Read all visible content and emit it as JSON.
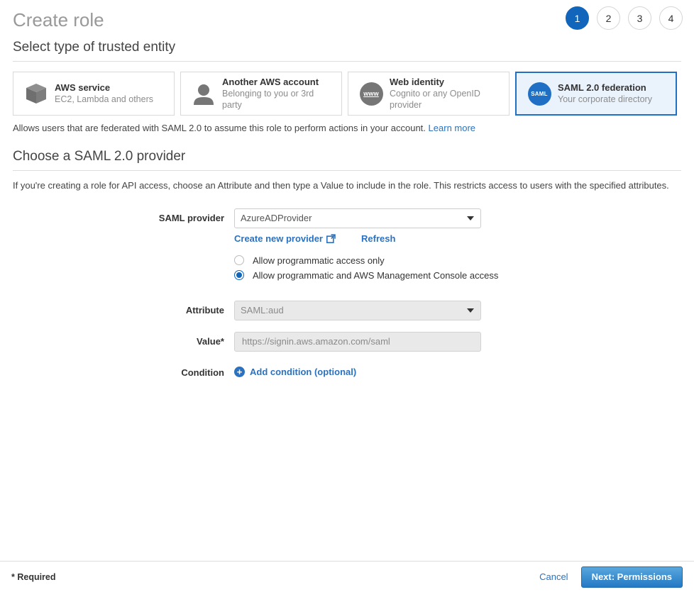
{
  "header": {
    "title": "Create role",
    "steps": [
      {
        "label": "1",
        "active": true
      },
      {
        "label": "2",
        "active": false
      },
      {
        "label": "3",
        "active": false
      },
      {
        "label": "4",
        "active": false
      }
    ]
  },
  "section_entity": {
    "heading": "Select type of trusted entity",
    "cards": [
      {
        "title": "AWS service",
        "subtitle": "EC2, Lambda and others",
        "icon": "cube-icon",
        "selected": false
      },
      {
        "title": "Another AWS account",
        "subtitle": "Belonging to you or 3rd party",
        "icon": "person-icon",
        "selected": false
      },
      {
        "title": "Web identity",
        "subtitle": "Cognito or any OpenID provider",
        "icon": "www-globe-icon",
        "icon_text": "www",
        "selected": false
      },
      {
        "title": "SAML 2.0 federation",
        "subtitle": "Your corporate directory",
        "icon": "saml-badge-icon",
        "icon_text": "SAML",
        "selected": true
      }
    ],
    "helper_text": "Allows users that are federated with SAML 2.0 to assume this role to perform actions in your account.",
    "helper_link": "Learn more"
  },
  "section_provider": {
    "heading": "Choose a SAML 2.0 provider",
    "intro": "If you're creating a role for API access, choose an Attribute and then type a Value to include in the role. This restricts access to users with the specified attributes.",
    "saml_provider": {
      "label": "SAML provider",
      "value": "AzureADProvider",
      "options": [
        "AzureADProvider"
      ],
      "create_link": "Create new provider",
      "refresh_link": "Refresh"
    },
    "access_radios": {
      "options": [
        {
          "label": "Allow programmatic access only",
          "selected": false
        },
        {
          "label": "Allow programmatic and AWS Management Console access",
          "selected": true
        }
      ]
    },
    "attribute": {
      "label": "Attribute",
      "value": "SAML:aud",
      "options": [
        "SAML:aud"
      ],
      "disabled": true
    },
    "value_field": {
      "label": "Value*",
      "value": "https://signin.aws.amazon.com/saml",
      "placeholder": "",
      "disabled": true
    },
    "condition": {
      "label": "Condition",
      "add_link": "Add condition (optional)"
    }
  },
  "footer": {
    "required_note": "* Required",
    "cancel_label": "Cancel",
    "next_label": "Next: Permissions"
  },
  "colors": {
    "accent_blue": "#1f6fc4",
    "link_blue": "#2a72c0",
    "selected_card_bg": "#eaf2fb",
    "icon_gray": "#767676",
    "disabled_bg": "#e9e9e9"
  }
}
